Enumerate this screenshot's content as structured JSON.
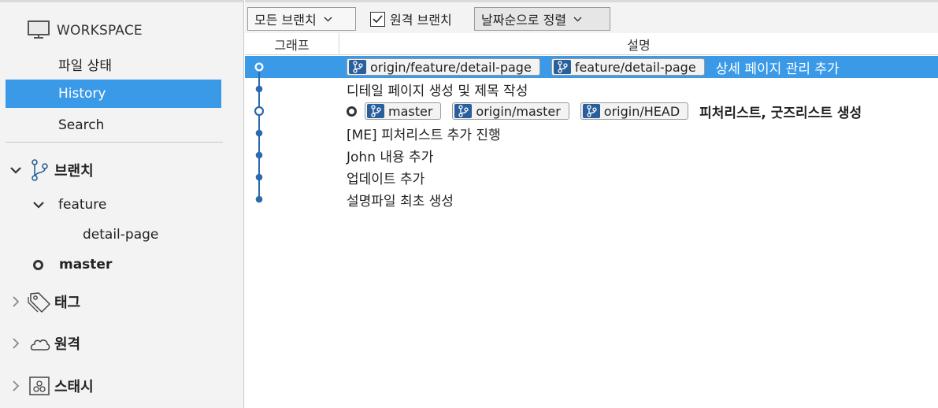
{
  "sidebar": {
    "workspace": {
      "label": "WORKSPACE",
      "items": [
        {
          "label": "파일 상태"
        },
        {
          "label": "History"
        },
        {
          "label": "Search"
        }
      ]
    },
    "sections": {
      "branches": "브랜치",
      "tags": "태그",
      "remotes": "원격",
      "stashes": "스태시"
    },
    "branch_tree": {
      "folder": "feature",
      "child": "detail-page",
      "current": "master"
    }
  },
  "toolbar": {
    "branch_filter": "모든 브랜치",
    "remote_branches_label": "원격 브랜치",
    "remote_branches_checked": true,
    "sort": "날짜순으로 정렬"
  },
  "columns": {
    "graph": "그래프",
    "description": "설명"
  },
  "commits": [
    {
      "badges": [
        "origin/feature/detail-page",
        "feature/detail-page"
      ],
      "message": "상세 페이지 관리 추가",
      "selected": true
    },
    {
      "badges": [],
      "message": "디테일 페이지 생성 및 제목 작성"
    },
    {
      "badges": [
        "master",
        "origin/master",
        "origin/HEAD"
      ],
      "message": "피처리스트, 굿즈리스트 생성",
      "head": true
    },
    {
      "badges": [],
      "message": "[ME] 피처리스트 추가 진행"
    },
    {
      "badges": [],
      "message": "John 내용 추가"
    },
    {
      "badges": [],
      "message": "업데이트 추가"
    },
    {
      "badges": [],
      "message": "설명파일 최초 생성"
    }
  ],
  "colors": {
    "selection": "#3b9ae8",
    "graph_line": "#2c69ad",
    "badge_icon_bg": "#285f9c"
  },
  "icons": {
    "workspace": "monitor-icon",
    "branches": "branch-icon",
    "tags": "tag-icon",
    "remotes": "cloud-icon",
    "stashes": "stash-icon"
  }
}
